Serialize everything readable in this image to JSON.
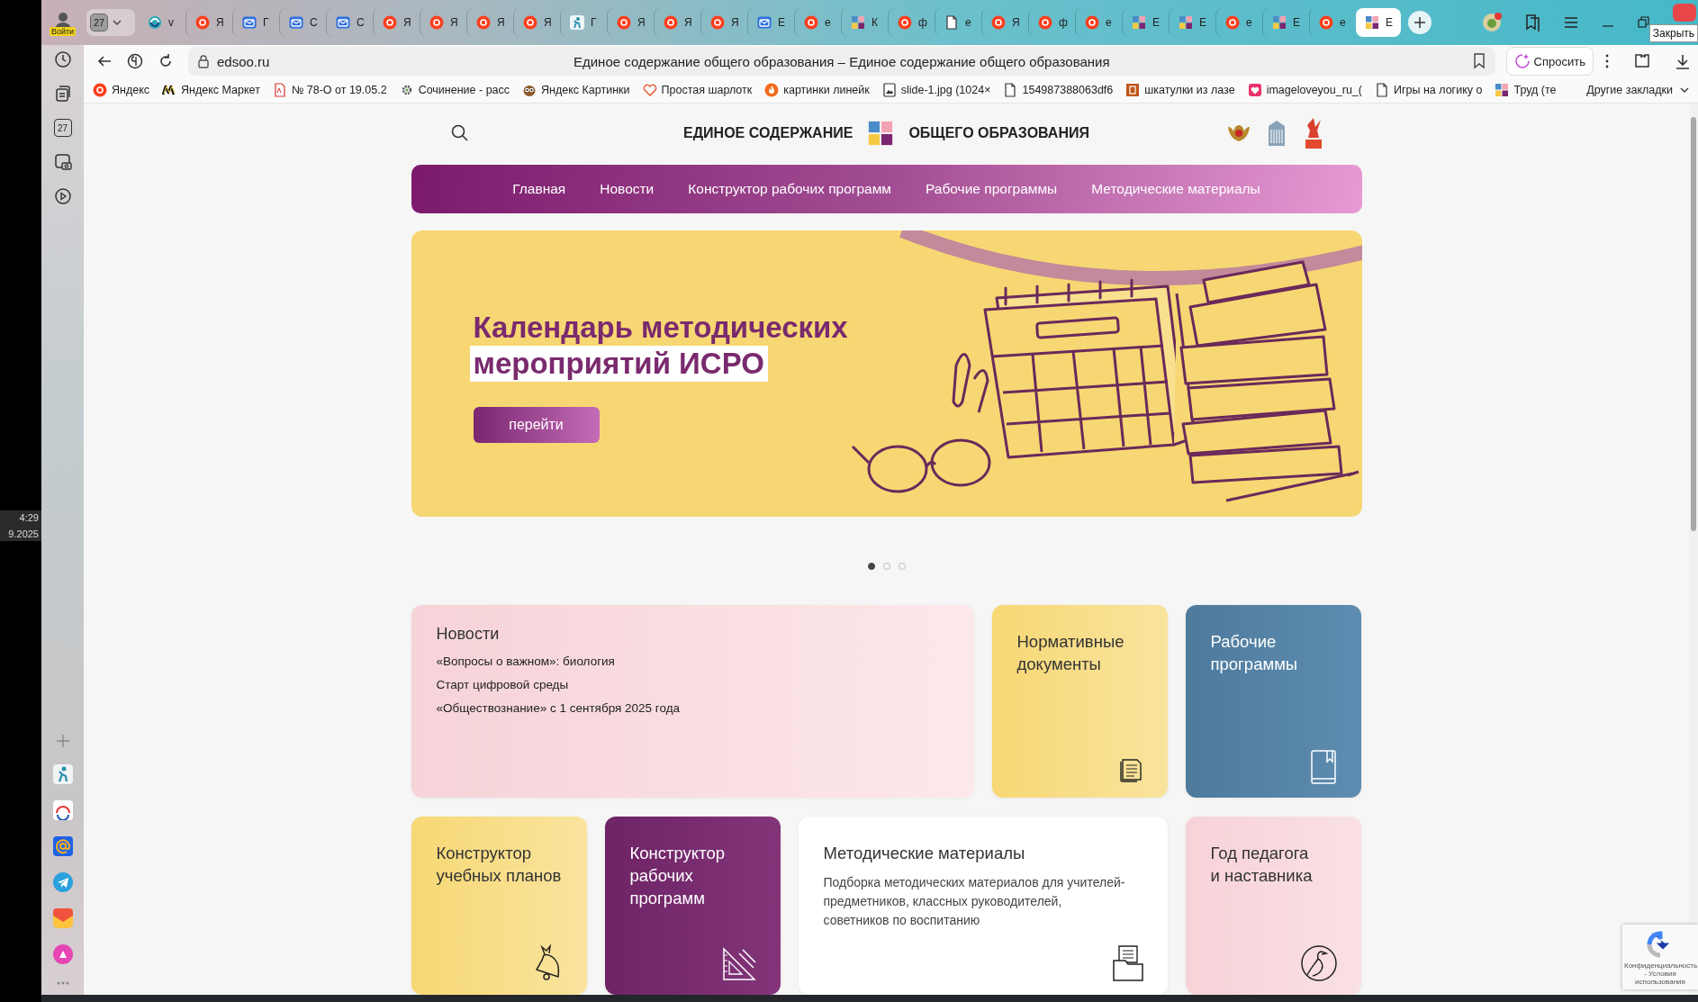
{
  "clock": {
    "time": "4:29",
    "date": "9.2025"
  },
  "account": {
    "label": "Войти"
  },
  "tab_group": {
    "count": "27"
  },
  "tabs": [
    {
      "kind": "app",
      "label": "v",
      "selected": false
    },
    {
      "kind": "yandex",
      "label": "Я",
      "selected": false
    },
    {
      "kind": "mail",
      "label": "Г",
      "selected": false
    },
    {
      "kind": "mail",
      "label": "С",
      "selected": false
    },
    {
      "kind": "mail",
      "label": "С",
      "selected": false
    },
    {
      "kind": "yandex",
      "label": "Я",
      "selected": false
    },
    {
      "kind": "yandex",
      "label": "Я",
      "selected": false
    },
    {
      "kind": "yandex",
      "label": "Я",
      "selected": false
    },
    {
      "kind": "yandex",
      "label": "Я",
      "selected": false
    },
    {
      "kind": "figure",
      "label": "Г",
      "selected": false
    },
    {
      "kind": "yandex",
      "label": "Я",
      "selected": false
    },
    {
      "kind": "yandex",
      "label": "Я",
      "selected": false
    },
    {
      "kind": "yandex",
      "label": "Я",
      "selected": false
    },
    {
      "kind": "mail",
      "label": "Е",
      "selected": false
    },
    {
      "kind": "yandex",
      "label": "е",
      "selected": false
    },
    {
      "kind": "tiles",
      "label": "К",
      "selected": false
    },
    {
      "kind": "yandex",
      "label": "ф",
      "selected": false
    },
    {
      "kind": "doc",
      "label": "е",
      "selected": false
    },
    {
      "kind": "yandex",
      "label": "Я",
      "selected": false
    },
    {
      "kind": "yandex",
      "label": "ф",
      "selected": false
    },
    {
      "kind": "yandex",
      "label": "е",
      "selected": false
    },
    {
      "kind": "tiles",
      "label": "Е",
      "selected": false
    },
    {
      "kind": "tiles",
      "label": "Е",
      "selected": false
    },
    {
      "kind": "yandex",
      "label": "е",
      "selected": false
    },
    {
      "kind": "tiles",
      "label": "Е",
      "selected": false
    },
    {
      "kind": "yandex",
      "label": "е",
      "selected": false
    },
    {
      "kind": "tiles",
      "label": "Е",
      "selected": true
    }
  ],
  "tooltip": "Закрыть",
  "address_bar": {
    "url": "edsoo.ru",
    "page_title": "Единое содержание общего образования – Единое содержание общего образования",
    "ask_button": "Спросить"
  },
  "bookmarks": [
    {
      "kind": "yandex",
      "label": "Яндекс"
    },
    {
      "kind": "market",
      "label": "Яндекс Маркет"
    },
    {
      "kind": "pdf",
      "label": "№ 78-О от 19.05.2"
    },
    {
      "kind": "gear",
      "label": "Сочинение - расс"
    },
    {
      "kind": "owl",
      "label": "Яндекс Картинки"
    },
    {
      "kind": "heart",
      "label": "Простая шарлотк"
    },
    {
      "kind": "flame",
      "label": "картинки линейк"
    },
    {
      "kind": "image",
      "label": "slide-1.jpg (1024×"
    },
    {
      "kind": "doc",
      "label": "154987388063df6"
    },
    {
      "kind": "letter",
      "label": "шкатулки из лазе"
    },
    {
      "kind": "heartsquare",
      "label": "imageloveyou_ru_("
    },
    {
      "kind": "doc",
      "label": "Игры на логику о"
    },
    {
      "kind": "tiles",
      "label": "Труд (те"
    }
  ],
  "other_bookmarks": "Другие закладки",
  "sidebar": {
    "calendar_day": "27"
  },
  "site": {
    "header": {
      "title_left": "ЕДИНОЕ СОДЕРЖАНИЕ",
      "title_right": "ОБЩЕГО ОБРАЗОВАНИЯ"
    },
    "nav": [
      "Главная",
      "Новости",
      "Конструктор рабочих программ",
      "Рабочие программы",
      "Методические материалы"
    ],
    "banner": {
      "title_line_1": "Календарь методических",
      "title_line_2": "мероприятий ИСРО",
      "button": "перейти"
    },
    "slides": [
      {
        "selected": true
      },
      {
        "selected": false
      },
      {
        "selected": false
      }
    ],
    "news": {
      "title": "Новости",
      "items": [
        "«Вопросы о важном»: биология",
        "Старт цифровой среды",
        "«Обществознание» с 1 сентября 2025 года"
      ]
    },
    "cards": [
      {
        "kind": "tile",
        "title": "Нормативные\nдокументы",
        "color": "#f7d874"
      },
      {
        "kind": "tile",
        "title": "Рабочие\nпрограммы",
        "color": "#4e7a9c"
      },
      {
        "kind": "tile",
        "title": "Конструктор\nучебных планов",
        "color": "#f7d874"
      },
      {
        "kind": "tile",
        "title": "Конструктор\nрабочих\nпрограмм",
        "color": "#6e2466"
      },
      {
        "kind": "wide",
        "title": "Методические материалы",
        "description": "Подборка методических материалов для учителей-предметников, классных руководителей, советников по воспитанию",
        "color": "#ffffff"
      },
      {
        "kind": "tile",
        "title": "Год педагога\nи наставника",
        "color": "#f7d3d8"
      }
    ]
  },
  "recaptcha": {
    "text": "Конфиденциальность - Условия использования"
  }
}
